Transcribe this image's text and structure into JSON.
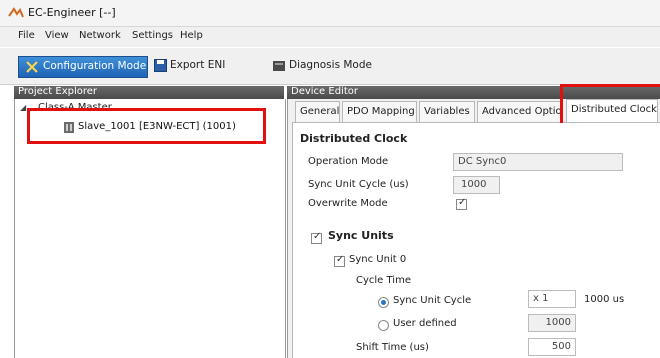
{
  "window": {
    "title": "EC-Engineer [--]"
  },
  "menu": [
    "File",
    "View",
    "Network",
    "Settings",
    "Help"
  ],
  "toolbar": {
    "configuration_mode": "Configuration Mode",
    "export_eni": "Export ENI",
    "diagnosis_mode": "Diagnosis Mode"
  },
  "project_explorer": {
    "header": "Project Explorer",
    "master_label": "Class-A Master",
    "slave_label": "Slave_1001 [E3NW-ECT] (1001)"
  },
  "device_editor": {
    "header": "Device Editor",
    "tabs": [
      "General",
      "PDO Mapping",
      "Variables",
      "Advanced Options",
      "Distributed Clock"
    ],
    "active_tab": "Distributed Clock",
    "section_title": "Distributed Clock",
    "operation_mode_label": "Operation Mode",
    "operation_mode_value": "DC Sync0",
    "sync_unit_cycle_label": "Sync Unit Cycle (us)",
    "sync_unit_cycle_value": "1000",
    "overwrite_mode_label": "Overwrite Mode",
    "sync_units_label": "Sync Units",
    "sync_unit0_label": "Sync Unit 0",
    "cycle_time_label": "Cycle Time",
    "radio_sync_unit_cycle": "Sync Unit Cycle",
    "multiplier_value": "x 1",
    "multiplier_result": "1000 us",
    "radio_user_defined": "User defined",
    "user_defined_value": "1000",
    "shift_time_label": "Shift Time (us)",
    "shift_time_value": "500"
  },
  "colors": {
    "highlight": "#e01010",
    "accent": "#2a72c8",
    "header_bg": "#555555"
  }
}
